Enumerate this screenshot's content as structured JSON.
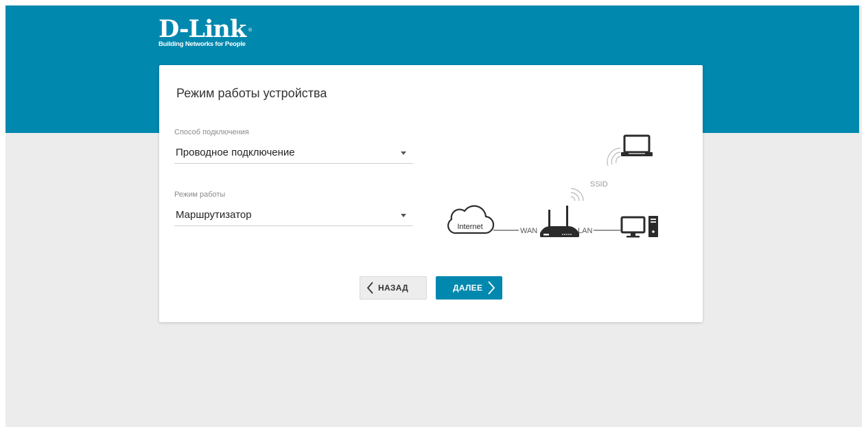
{
  "brand": {
    "logo_text": "D-Link",
    "tagline": "Building Networks for People",
    "registered_mark": "®"
  },
  "page": {
    "title": "Режим работы устройства"
  },
  "connection_type": {
    "label": "Способ подключения",
    "value": "Проводное подключение"
  },
  "work_mode": {
    "label": "Режим работы",
    "value": "Маршрутизатор"
  },
  "diagram": {
    "internet_label": "Internet",
    "wan_label": "WAN",
    "lan_label": "LAN",
    "ssid_label": "SSID"
  },
  "buttons": {
    "back_label": "НАЗАД",
    "next_label": "ДАЛЕЕ"
  },
  "colors": {
    "brand_blue": "#0088ae",
    "page_background": "#ececec",
    "card_background": "#ffffff",
    "icon_dark": "#2b2b2b"
  }
}
